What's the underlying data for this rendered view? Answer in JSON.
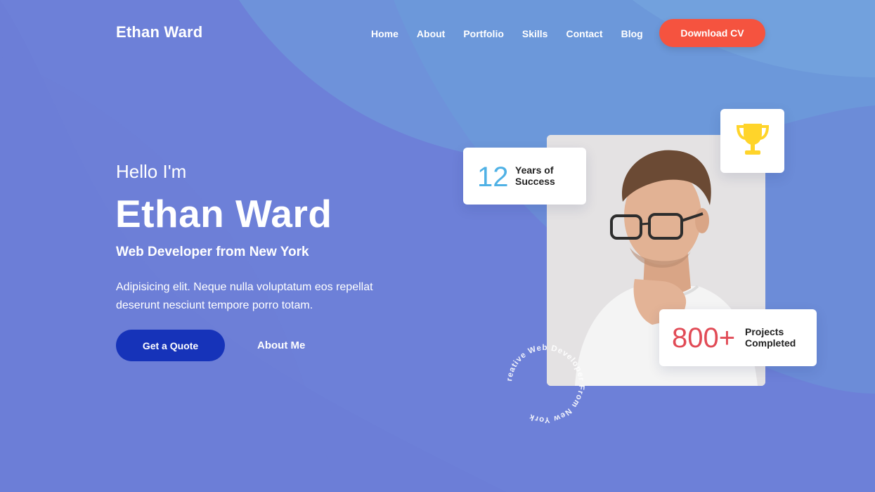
{
  "brand": {
    "name": "Ethan Ward"
  },
  "nav": {
    "items": [
      "Home",
      "About",
      "Portfolio",
      "Skills",
      "Contact",
      "Blog"
    ]
  },
  "header": {
    "cta_label": "Download CV"
  },
  "hero": {
    "greeting": "Hello I'm",
    "name": "Ethan Ward",
    "role": "Web Developer from New York",
    "description": "Adipisicing elit. Neque nulla voluptatum eos repellat deserunt nesciunt tempore porro totam.",
    "primary_button": "Get a Quote",
    "secondary_link": "About Me"
  },
  "stats": {
    "years": {
      "value": "12",
      "label": "Years of Success"
    },
    "projects": {
      "value": "800+",
      "label": "Projects Completed"
    }
  },
  "circle_text": "Creative Web Developer From New York",
  "icons": {
    "trophy": "trophy-icon",
    "portrait": "portrait-image"
  },
  "colors": {
    "background": "#6d80d8",
    "cta": "#f5533f",
    "primary_button": "#1633b9",
    "years_number": "#4fb1e5",
    "projects_number": "#e14b56",
    "trophy": "#ffd42a"
  }
}
